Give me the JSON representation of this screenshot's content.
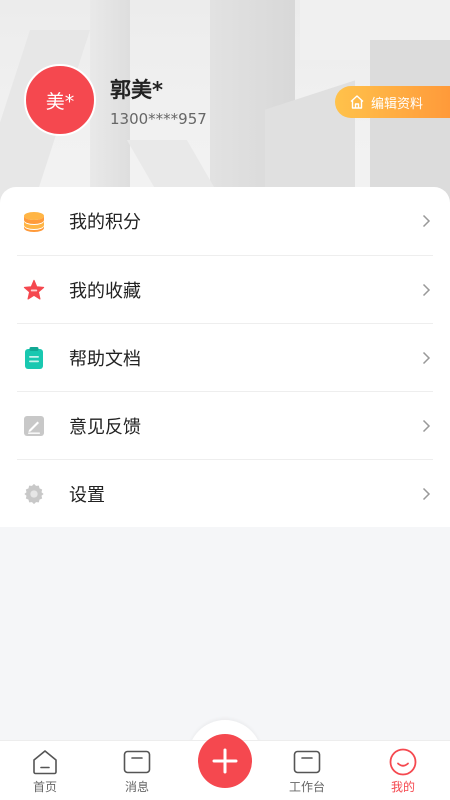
{
  "profile": {
    "avatar_text": "美*",
    "name": "郭美*",
    "phone": "1300****957",
    "edit_label": "编辑资料"
  },
  "menu": {
    "items": [
      {
        "label": "我的积分",
        "icon": "coins-icon",
        "color": "#ff9a3a"
      },
      {
        "label": "我的收藏",
        "icon": "star-icon",
        "color": "#f5484f"
      },
      {
        "label": "帮助文档",
        "icon": "clipboard-icon",
        "color": "#19c8b0"
      },
      {
        "label": "意见反馈",
        "icon": "feedback-edit-icon",
        "color": "#c8c8c8"
      },
      {
        "label": "设置",
        "icon": "gear-icon",
        "color": "#c8c8c8"
      }
    ]
  },
  "tabbar": {
    "tabs": [
      {
        "label": "首页",
        "icon": "home-icon"
      },
      {
        "label": "消息",
        "icon": "message-icon"
      },
      {
        "label": "工作台",
        "icon": "workbench-icon"
      },
      {
        "label": "我的",
        "icon": "smile-icon",
        "active": true
      }
    ],
    "add_icon": "plus-icon"
  },
  "colors": {
    "accent": "#f5484f",
    "edit_gradient_start": "#ffc24b",
    "edit_gradient_end": "#ff9a3a"
  }
}
